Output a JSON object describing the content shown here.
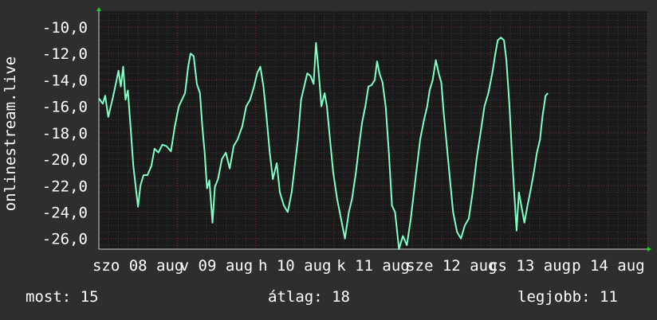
{
  "chart_data": {
    "type": "line",
    "ylabel": "onlinestream.live",
    "ylim": [
      -26.8,
      -8.8
    ],
    "yticks": [
      -10,
      -12,
      -14,
      -16,
      -18,
      -20,
      -22,
      -24,
      -26
    ],
    "ytick_labels": [
      "-10,0",
      "-12,0",
      "-14,0",
      "-16,0",
      "-18,0",
      "-20,0",
      "-22,0",
      "-24,0",
      "-26,0"
    ],
    "xlim": [
      0,
      7.0
    ],
    "xticks": [
      0,
      1,
      2,
      3,
      4,
      5,
      6,
      7
    ],
    "xtick_labels": [
      "szo 08 aug",
      "v 09 aug",
      "h 10 aug",
      "k 11 aug",
      "sze 12 aug",
      "cs 13 aug",
      "p 14 aug",
      ""
    ],
    "xtick_text": [
      {
        "text": "szo 08 aug"
      },
      {
        "text": "v 09 aug"
      },
      {
        "text": "h 10 aug"
      },
      {
        "text": "k 11 aug"
      },
      {
        "text": "sze 12 aug"
      },
      {
        "text": "cs 13 aug"
      },
      {
        "text": "p 14 aug"
      }
    ],
    "grid": true,
    "series": [
      {
        "color": "#7fffc4",
        "points": [
          [
            0.0,
            -15.4
          ],
          [
            0.05,
            -15.8
          ],
          [
            0.08,
            -15.2
          ],
          [
            0.12,
            -16.8
          ],
          [
            0.18,
            -15.3
          ],
          [
            0.22,
            -14.2
          ],
          [
            0.25,
            -13.3
          ],
          [
            0.28,
            -14.5
          ],
          [
            0.31,
            -13.0
          ],
          [
            0.34,
            -15.5
          ],
          [
            0.37,
            -14.8
          ],
          [
            0.41,
            -18.0
          ],
          [
            0.44,
            -20.5
          ],
          [
            0.5,
            -23.6
          ],
          [
            0.53,
            -22.0
          ],
          [
            0.57,
            -21.2
          ],
          [
            0.62,
            -21.2
          ],
          [
            0.67,
            -20.5
          ],
          [
            0.71,
            -19.2
          ],
          [
            0.76,
            -19.5
          ],
          [
            0.81,
            -18.9
          ],
          [
            0.86,
            -19.0
          ],
          [
            0.92,
            -19.4
          ],
          [
            0.97,
            -17.5
          ],
          [
            1.02,
            -16.0
          ],
          [
            1.06,
            -15.5
          ],
          [
            1.1,
            -15.0
          ],
          [
            1.14,
            -13.0
          ],
          [
            1.17,
            -12.0
          ],
          [
            1.21,
            -12.2
          ],
          [
            1.25,
            -14.3
          ],
          [
            1.29,
            -15.0
          ],
          [
            1.32,
            -17.5
          ],
          [
            1.35,
            -19.5
          ],
          [
            1.38,
            -22.2
          ],
          [
            1.41,
            -21.6
          ],
          [
            1.45,
            -24.8
          ],
          [
            1.48,
            -22.1
          ],
          [
            1.52,
            -21.5
          ],
          [
            1.57,
            -20.0
          ],
          [
            1.62,
            -19.5
          ],
          [
            1.67,
            -20.7
          ],
          [
            1.72,
            -19.0
          ],
          [
            1.77,
            -18.5
          ],
          [
            1.83,
            -17.5
          ],
          [
            1.88,
            -16.0
          ],
          [
            1.93,
            -15.5
          ],
          [
            1.98,
            -14.5
          ],
          [
            2.02,
            -13.5
          ],
          [
            2.06,
            -13.0
          ],
          [
            2.1,
            -14.5
          ],
          [
            2.14,
            -16.8
          ],
          [
            2.18,
            -19.5
          ],
          [
            2.22,
            -21.5
          ],
          [
            2.27,
            -20.3
          ],
          [
            2.31,
            -22.5
          ],
          [
            2.36,
            -23.5
          ],
          [
            2.41,
            -24.0
          ],
          [
            2.46,
            -22.5
          ],
          [
            2.5,
            -20.5
          ],
          [
            2.54,
            -18.5
          ],
          [
            2.58,
            -15.5
          ],
          [
            2.62,
            -14.5
          ],
          [
            2.66,
            -13.5
          ],
          [
            2.7,
            -13.7
          ],
          [
            2.74,
            -14.3
          ],
          [
            2.77,
            -11.2
          ],
          [
            2.81,
            -13.8
          ],
          [
            2.84,
            -16.0
          ],
          [
            2.88,
            -15.0
          ],
          [
            2.91,
            -16.0
          ],
          [
            2.95,
            -18.5
          ],
          [
            2.99,
            -21.0
          ],
          [
            3.04,
            -23.0
          ],
          [
            3.09,
            -24.5
          ],
          [
            3.14,
            -26.0
          ],
          [
            3.19,
            -24.0
          ],
          [
            3.23,
            -23.0
          ],
          [
            3.28,
            -21.0
          ],
          [
            3.32,
            -19.0
          ],
          [
            3.36,
            -17.2
          ],
          [
            3.4,
            -16.0
          ],
          [
            3.44,
            -14.5
          ],
          [
            3.48,
            -14.4
          ],
          [
            3.52,
            -14.0
          ],
          [
            3.55,
            -12.6
          ],
          [
            3.58,
            -13.5
          ],
          [
            3.62,
            -14.2
          ],
          [
            3.66,
            -16.0
          ],
          [
            3.7,
            -19.5
          ],
          [
            3.74,
            -23.5
          ],
          [
            3.78,
            -24.0
          ],
          [
            3.83,
            -26.8
          ],
          [
            3.88,
            -25.8
          ],
          [
            3.93,
            -26.5
          ],
          [
            3.98,
            -24.5
          ],
          [
            4.02,
            -22.5
          ],
          [
            4.06,
            -20.5
          ],
          [
            4.1,
            -18.5
          ],
          [
            4.15,
            -17.0
          ],
          [
            4.19,
            -16.0
          ],
          [
            4.22,
            -14.8
          ],
          [
            4.26,
            -14.0
          ],
          [
            4.3,
            -12.5
          ],
          [
            4.34,
            -13.6
          ],
          [
            4.37,
            -14.2
          ],
          [
            4.4,
            -16.5
          ],
          [
            4.44,
            -19.0
          ],
          [
            4.48,
            -21.5
          ],
          [
            4.52,
            -24.0
          ],
          [
            4.57,
            -25.5
          ],
          [
            4.62,
            -26.0
          ],
          [
            4.67,
            -25.0
          ],
          [
            4.72,
            -24.5
          ],
          [
            4.77,
            -22.5
          ],
          [
            4.82,
            -20.0
          ],
          [
            4.87,
            -18.0
          ],
          [
            4.92,
            -16.0
          ],
          [
            4.97,
            -15.0
          ],
          [
            5.02,
            -13.5
          ],
          [
            5.06,
            -12.0
          ],
          [
            5.09,
            -11.0
          ],
          [
            5.13,
            -10.8
          ],
          [
            5.17,
            -11.0
          ],
          [
            5.2,
            -12.5
          ],
          [
            5.24,
            -16.0
          ],
          [
            5.27,
            -19.5
          ],
          [
            5.3,
            -22.5
          ],
          [
            5.33,
            -25.4
          ],
          [
            5.36,
            -22.5
          ],
          [
            5.4,
            -23.8
          ],
          [
            5.43,
            -24.8
          ],
          [
            5.47,
            -23.5
          ],
          [
            5.51,
            -22.3
          ],
          [
            5.55,
            -21.0
          ],
          [
            5.59,
            -19.5
          ],
          [
            5.63,
            -18.5
          ],
          [
            5.66,
            -16.8
          ],
          [
            5.7,
            -15.2
          ],
          [
            5.73,
            -15.0
          ]
        ]
      }
    ]
  },
  "footer": {
    "current": "most: 15",
    "average": "átlag: 18",
    "max": "legjobb: 11"
  }
}
